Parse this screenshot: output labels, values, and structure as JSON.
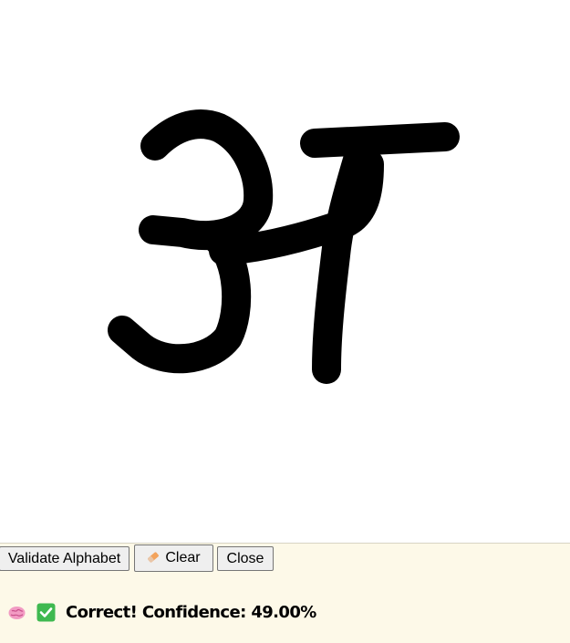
{
  "canvas": {
    "description_icon": "drawing-canvas",
    "stroke_color": "#000000",
    "background": "#ffffff"
  },
  "toolbar": {
    "validate_label": "Validate Alphabet",
    "clear_label": "Clear",
    "clear_icon": "eraser-icon",
    "close_label": "Close"
  },
  "result": {
    "brain_icon": "brain-icon",
    "check_icon": "check-mark-icon",
    "text": "Correct! Confidence: 49.00%",
    "check_color": "#3fb950"
  },
  "colors": {
    "panel_background": "#fdf9e8",
    "canvas_background": "#ffffff"
  }
}
